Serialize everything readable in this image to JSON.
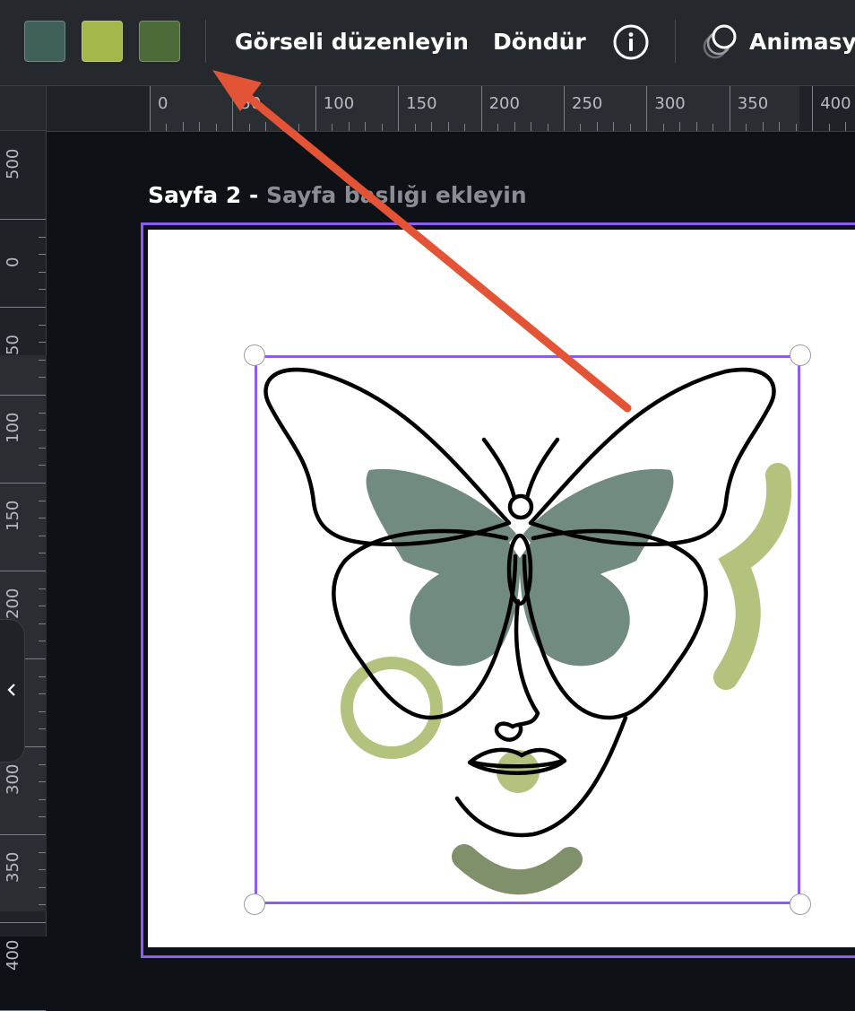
{
  "toolbar": {
    "swatches": [
      {
        "name": "dark-teal",
        "color": "#3f6159"
      },
      {
        "name": "olive-green",
        "color": "#a4b74a"
      },
      {
        "name": "forest-green",
        "color": "#4d6b39"
      }
    ],
    "edit_image_label": "Görseli düzenleyin",
    "rotate_label": "Döndür",
    "animate_label": "Animasyo"
  },
  "ruler": {
    "top_ticks": [
      "0",
      "50",
      "100",
      "150",
      "200",
      "250",
      "300",
      "350",
      "400"
    ],
    "left_ticks": [
      "500",
      "0",
      "50",
      "100",
      "150",
      "200",
      "250",
      "300",
      "350",
      "400"
    ]
  },
  "page": {
    "number_label": "Sayfa 2 -",
    "title_placeholder": "Sayfa başlığı ekleyin"
  },
  "colors": {
    "selection": "#8b5cf6",
    "annotation_arrow": "#e35436",
    "butterfly_fill": "#718b80",
    "accent_green": "#b3c27c",
    "smile_green": "#80906b"
  },
  "icons": {
    "info": "info-icon",
    "animate": "animate-icon",
    "collapse": "chevron-left-icon"
  }
}
